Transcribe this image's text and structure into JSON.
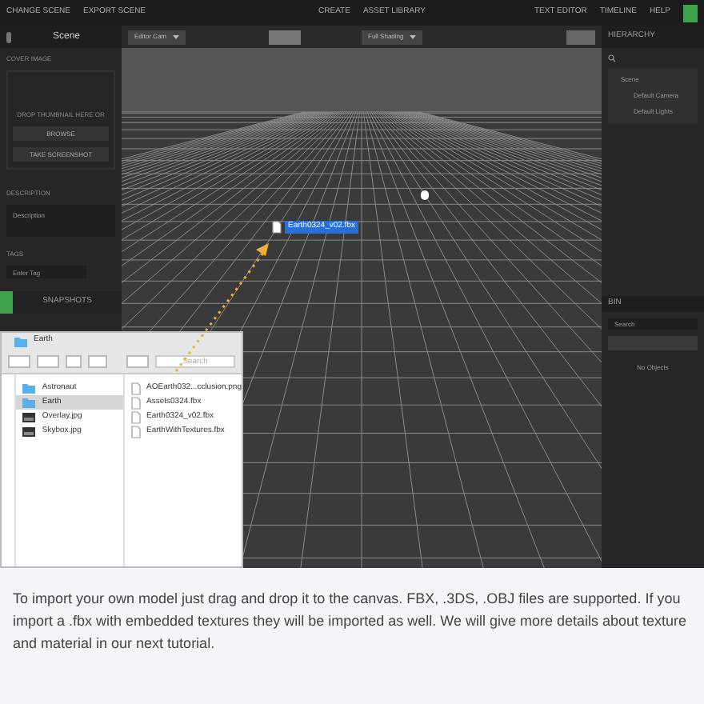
{
  "top_bar": {
    "left": [
      "CHANGE SCENE",
      "EXPORT SCENE"
    ],
    "center": [
      "CREATE",
      "ASSET LIBRARY"
    ],
    "right": [
      "TEXT EDITOR",
      "TIMELINE",
      "HELP"
    ]
  },
  "scene_panel": {
    "title": "Scene",
    "cover_label": "COVER IMAGE",
    "drop_hint": "DROP THUMBNAIL HERE OR",
    "buttons": [
      "BROWSE",
      "TAKE SCREENSHOT"
    ],
    "description_label": "DESCRIPTION",
    "description_placeholder": "Description",
    "tags_label": "TAGS",
    "tag_placeholder": "Enter Tag",
    "section": "SNAPSHOTS"
  },
  "viewport": {
    "camera": "Editor Cam",
    "shading": "Full Shading",
    "dragged_file": "Earth0324_v02.fbx"
  },
  "hierarchy": {
    "title": "HIERARCHY",
    "tree": [
      {
        "label": "Scene",
        "children": [
          {
            "label": "Default Camera"
          },
          {
            "label": "Default Lights"
          }
        ]
      }
    ]
  },
  "bin": {
    "title": "BIN",
    "search_placeholder": "Search",
    "empty_text": "No Objects"
  },
  "finder": {
    "title": "Earth",
    "search_placeholder": "Search",
    "folders": [
      {
        "name": "Astronaut",
        "kind": "folder",
        "selected": false
      },
      {
        "name": "Earth",
        "kind": "folder",
        "selected": true
      },
      {
        "name": "Overlay.jpg",
        "kind": "image",
        "selected": false
      },
      {
        "name": "Skybox.jpg",
        "kind": "image",
        "selected": false
      }
    ],
    "files": [
      "AOEarth032...cclusion.png",
      "Assets0324.fbx",
      "Earth0324_v02.fbx",
      "EarthWithTextures.fbx"
    ]
  },
  "caption": "To import your own model just drag and drop it to the canvas. FBX, .3DS, .OBJ files are supported. If you import a .fbx with embedded textures they will be imported as well. We will give more details about texture and material in our next tutorial."
}
